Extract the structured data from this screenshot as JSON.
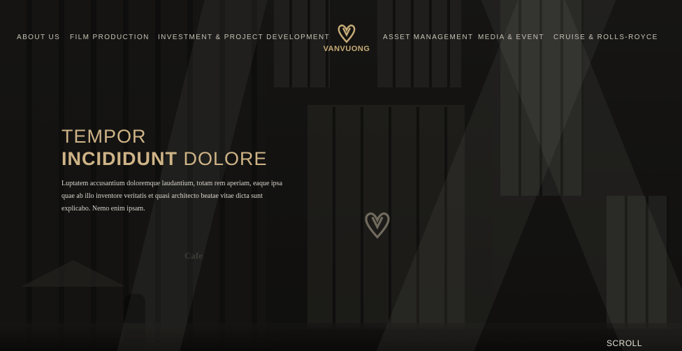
{
  "nav": {
    "left": [
      "ABOUT US",
      "FILM PRODUCTION",
      "INVESTMENT & PROJECT DEVELOPMENT"
    ],
    "right": [
      "ASSET MANAGEMENT",
      "MEDIA & EVENT",
      "CRUISE & ROLLS-ROYCE"
    ]
  },
  "logo": {
    "text": "VANVUONG",
    "icon": "double-v-heart-logo"
  },
  "hero": {
    "line1": "TEMPOR",
    "line2_strong": "INCIDIDUNT",
    "line2_light": "DOLORE",
    "description": "Luptatem accusantium doloremque laudantium, totam rem aperiam, eaque ipsa quae ab illo inventore veritatis et quasi architecto beatae vitae dicta sunt explicabo. Nemo enim ipsam."
  },
  "background": {
    "sign_text": "Cafe"
  },
  "scroll_label": "SCROLL",
  "colors": {
    "accent": "#c8ad78",
    "nav_text": "#c7c2b5",
    "background": "#0e0d0b"
  }
}
